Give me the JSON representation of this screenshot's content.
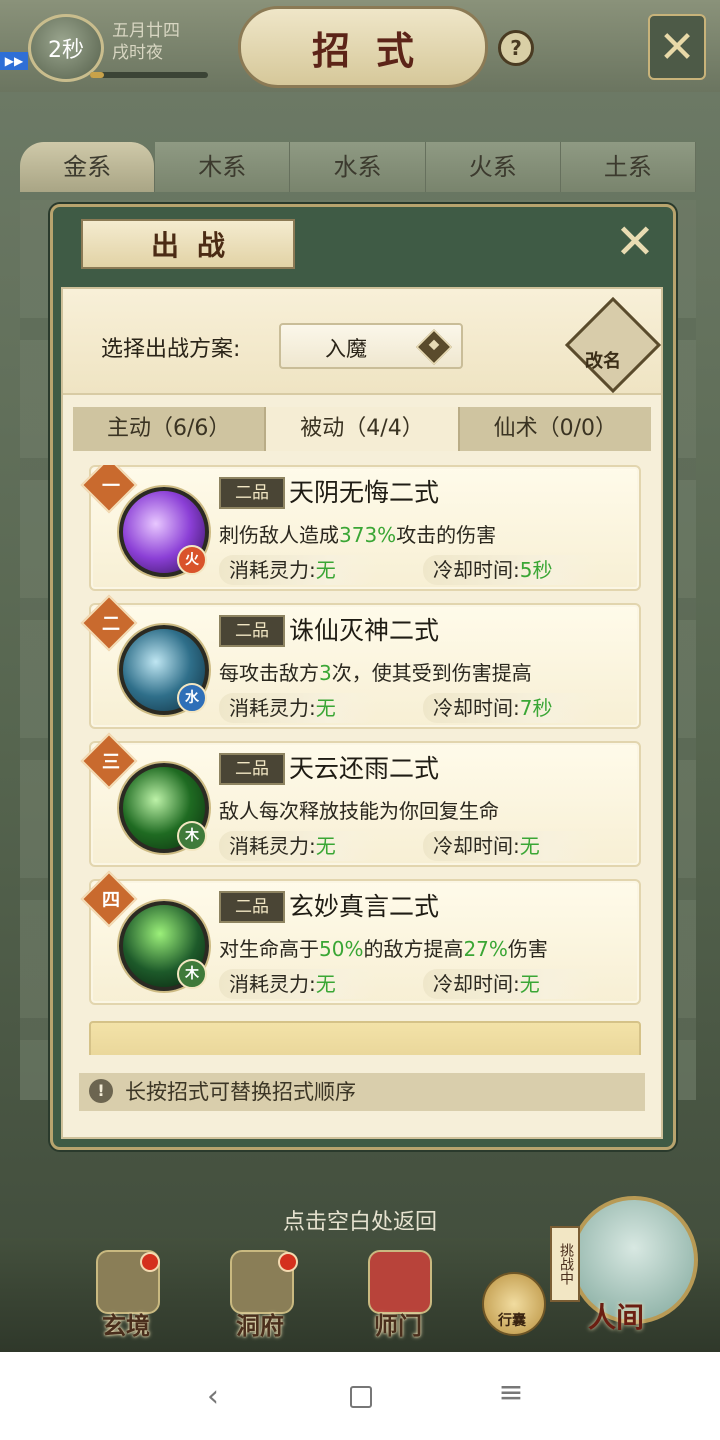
{
  "header": {
    "timer": "2秒",
    "date_line1": "五月廿四",
    "date_line2": "戌时夜",
    "title": "招式",
    "help_symbol": "?",
    "close_symbol": "✕"
  },
  "element_tabs": [
    "金系",
    "木系",
    "水系",
    "火系",
    "土系"
  ],
  "element_tabs_active": 0,
  "modal": {
    "title": "出战",
    "close_symbol": "✕",
    "plan_label": "选择出战方案:",
    "plan_value": "入魔",
    "rename_label": "改名",
    "skill_tabs": [
      "主动（6/6）",
      "被动（4/4）",
      "仙术（0/0）"
    ],
    "skill_tabs_active": 1,
    "skills": [
      {
        "rank": "一",
        "grade": "二品",
        "name": "天阴无悔二式",
        "desc_parts": [
          "刺伤敌人造成",
          "373%",
          "攻击的伤害",
          "",
          ""
        ],
        "cost_label": "消耗灵力:",
        "cost_value": "无",
        "cd_label": "冷却时间:",
        "cd_value": "5秒",
        "element": "火",
        "element_color": "#d9532b",
        "icon_color": "#8b3fd6"
      },
      {
        "rank": "二",
        "grade": "二品",
        "name": "诛仙灭神二式",
        "desc_parts": [
          "每攻击敌方",
          "3",
          "次，使其受到伤害提高",
          "",
          ""
        ],
        "cost_label": "消耗灵力:",
        "cost_value": "无",
        "cd_label": "冷却时间:",
        "cd_value": "7秒",
        "element": "水",
        "element_color": "#2f6fb8",
        "icon_color": "#2f6f8a"
      },
      {
        "rank": "三",
        "grade": "二品",
        "name": "天云还雨二式",
        "desc_parts": [
          "敌人每次释放技能为你回复生命",
          "",
          "",
          "",
          ""
        ],
        "cost_label": "消耗灵力:",
        "cost_value": "无",
        "cd_label": "冷却时间:",
        "cd_value": "无",
        "element": "木",
        "element_color": "#3f7a3a",
        "icon_color": "#1f6b22"
      },
      {
        "rank": "四",
        "grade": "二品",
        "name": "玄妙真言二式",
        "desc_parts": [
          "对生命高于",
          "50%",
          "的敌方提高",
          "27%",
          "伤害"
        ],
        "cost_label": "消耗灵力:",
        "cost_value": "无",
        "cd_label": "冷却时间:",
        "cd_value": "无",
        "element": "木",
        "element_color": "#3f7a3a",
        "icon_color": "#1d5a2a"
      }
    ],
    "hint_symbol": "!",
    "hint": "长按招式可替换招式顺序"
  },
  "back_hint": "点击空白处返回",
  "bottom_nav": {
    "items": [
      "玄境",
      "洞府",
      "师门"
    ],
    "xingnang": "行囊",
    "challenge": "挑战中",
    "renjian": "人间"
  },
  "system_nav": {
    "back": "‹",
    "menu": "≡"
  },
  "colors": {
    "accent_green": "#3aa635",
    "title_red": "#5c2418",
    "rank_orange": "#c96a2e"
  }
}
